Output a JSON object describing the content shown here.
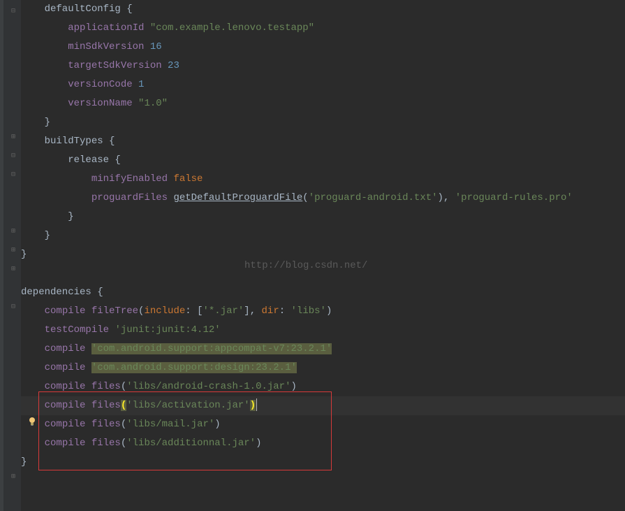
{
  "watermark": "http://blog.csdn.net/",
  "code": {
    "line1": {
      "text1": "    defaultConfig ",
      "brace": "{"
    },
    "line2": {
      "indent": "        ",
      "prop": "applicationId",
      "space": " ",
      "str": "\"com.example.lenovo.testapp\""
    },
    "line3": {
      "indent": "        ",
      "prop": "minSdkVersion",
      "space": " ",
      "num": "16"
    },
    "line4": {
      "indent": "        ",
      "prop": "targetSdkVersion",
      "space": " ",
      "num": "23"
    },
    "line5": {
      "indent": "        ",
      "prop": "versionCode",
      "space": " ",
      "num": "1"
    },
    "line6": {
      "indent": "        ",
      "prop": "versionName",
      "space": " ",
      "str": "\"1.0\""
    },
    "line7": {
      "brace": "    }"
    },
    "line8": {
      "text": "    buildTypes ",
      "brace": "{"
    },
    "line9": {
      "text": "        release ",
      "brace": "{"
    },
    "line10": {
      "indent": "            ",
      "prop": "minifyEnabled",
      "space": " ",
      "val": "false"
    },
    "line11": {
      "indent": "            ",
      "prop": "proguardFiles",
      "space": " ",
      "func": "getDefaultProguardFile",
      "paren1": "(",
      "str1": "'proguard-android.txt'",
      "paren2": ")",
      "comma": ", ",
      "str2": "'proguard-rules.pro'"
    },
    "line12": {
      "brace": "        }"
    },
    "line13": {
      "brace": "    }"
    },
    "line14": {
      "brace": "}"
    },
    "line15": {
      "empty": ""
    },
    "line16": {
      "text": "dependencies ",
      "brace": "{"
    },
    "line17": {
      "indent": "    ",
      "prop1": "compile",
      "space1": " ",
      "prop2": "fileTree",
      "paren1": "(",
      "key1": "include",
      "colon1": ": [",
      "str1": "'*.jar'",
      "mid": "], ",
      "key2": "dir",
      "colon2": ": ",
      "str2": "'libs'",
      "paren2": ")"
    },
    "line18": {
      "indent": "    ",
      "prop": "testCompile",
      "space": " ",
      "str": "'junit:junit:4.12'"
    },
    "line19": {
      "indent": "    ",
      "prop": "compile",
      "space": " ",
      "str": "'com.android.support:appcompat-v7:23.2.1'"
    },
    "line20": {
      "indent": "    ",
      "prop": "compile",
      "space": " ",
      "str": "'com.android.support:design:23.2.1'"
    },
    "line21": {
      "indent": "    ",
      "prop": "compile",
      "space": " ",
      "func": "files",
      "paren1": "(",
      "str": "'libs/android-crash-1.0.jar'",
      "paren2": ")"
    },
    "line22": {
      "indent": "    ",
      "prop": "compile",
      "space": " ",
      "func": "files",
      "paren1": "(",
      "str": "'libs/activation.jar'",
      "paren2": ")"
    },
    "line23": {
      "indent": "    ",
      "prop": "compile",
      "space": " ",
      "func": "files",
      "paren1": "(",
      "str": "'libs/mail.jar'",
      "paren2": ")"
    },
    "line24": {
      "indent": "    ",
      "prop": "compile",
      "space": " ",
      "func": "files",
      "paren1": "(",
      "str": "'libs/additionnal.jar'",
      "paren2": ")"
    },
    "line25": {
      "brace": "}"
    }
  }
}
